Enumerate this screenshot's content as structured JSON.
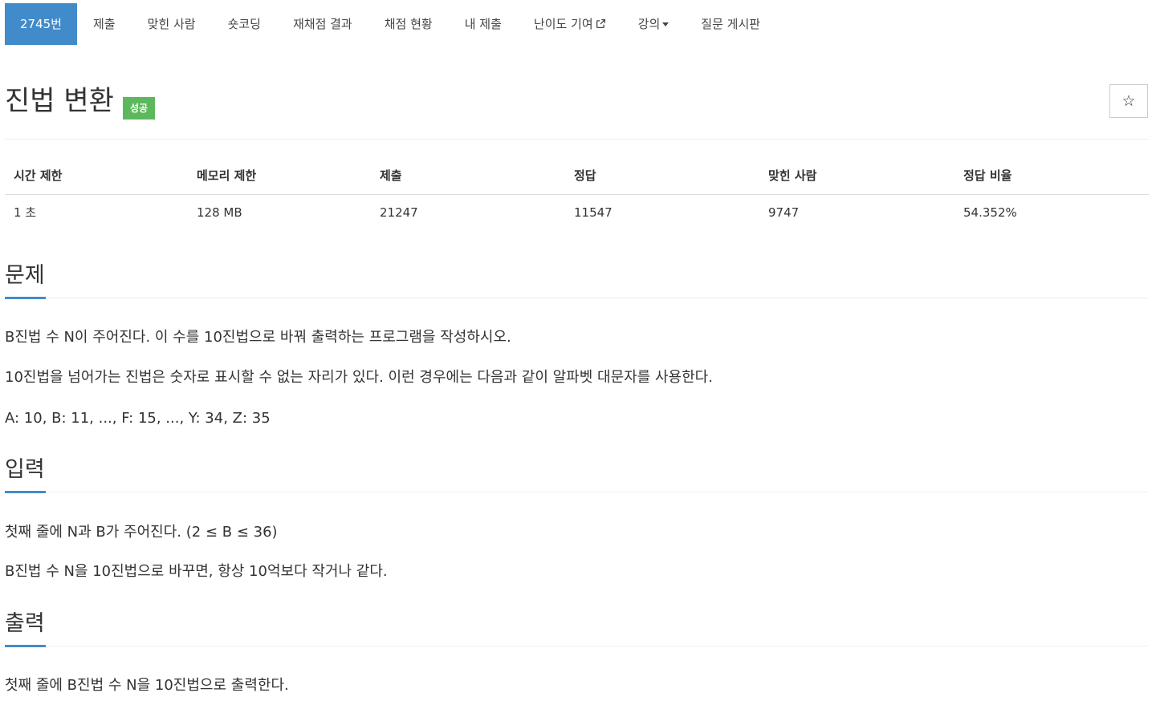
{
  "nav": {
    "tabs": [
      {
        "label": "2745번",
        "active": true
      },
      {
        "label": "제출"
      },
      {
        "label": "맞힌 사람"
      },
      {
        "label": "숏코딩"
      },
      {
        "label": "재채점 결과"
      },
      {
        "label": "채점 현황"
      },
      {
        "label": "내 제출"
      },
      {
        "label": "난이도 기여",
        "icon": "external-link-icon"
      },
      {
        "label": "강의",
        "icon": "caret-down-icon"
      },
      {
        "label": "질문 게시판"
      }
    ]
  },
  "problem": {
    "title": "진법 변환",
    "badge": "성공",
    "star_icon": "star-outline-icon",
    "star_glyph": "☆"
  },
  "info": {
    "headers": [
      "시간 제한",
      "메모리 제한",
      "제출",
      "정답",
      "맞힌 사람",
      "정답 비율"
    ],
    "values": [
      "1 초",
      "128 MB",
      "21247",
      "11547",
      "9747",
      "54.352%"
    ]
  },
  "sections": {
    "problem": {
      "heading": "문제",
      "paragraphs": [
        "B진법 수 N이 주어진다. 이 수를 10진법으로 바꿔 출력하는 프로그램을 작성하시오.",
        "10진법을 넘어가는 진법은 숫자로 표시할 수 없는 자리가 있다. 이런 경우에는 다음과 같이 알파벳 대문자를 사용한다.",
        "A: 10, B: 11, ..., F: 15, ..., Y: 34, Z: 35"
      ]
    },
    "input": {
      "heading": "입력",
      "paragraphs": [
        "첫째 줄에 N과 B가 주어진다. (2 ≤ B ≤ 36)",
        "B진법 수 N을 10진법으로 바꾸면, 항상 10억보다 작거나 같다."
      ]
    },
    "output": {
      "heading": "출력",
      "paragraphs": [
        "첫째 줄에 B진법 수 N을 10진법으로 출력한다."
      ]
    }
  },
  "colors": {
    "accent": "#428bca",
    "success": "#5cb85c"
  }
}
